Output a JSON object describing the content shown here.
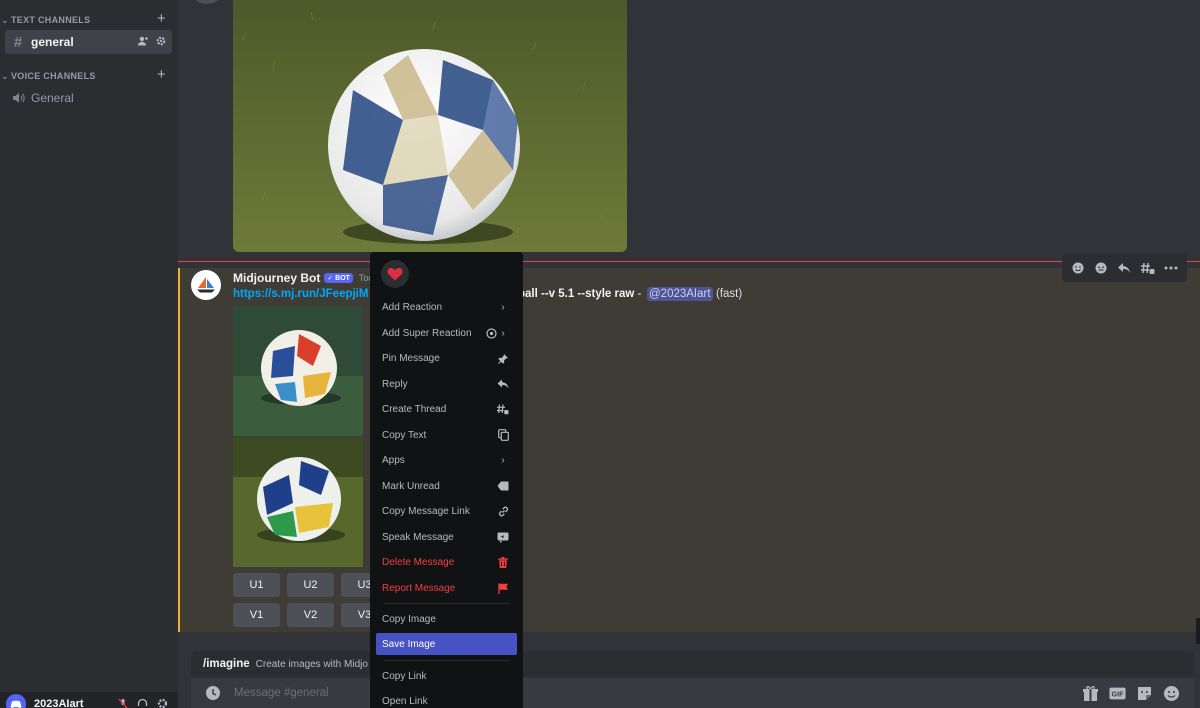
{
  "sidebar": {
    "text_channels_label": "TEXT CHANNELS",
    "voice_channels_label": "VOICE CHANNELS",
    "text_channel": "general",
    "voice_channel": "General"
  },
  "user": {
    "name": "2023AIart"
  },
  "message": {
    "author": "Midjourney Bot",
    "badge": "✓ BOT",
    "timestamp": "Today",
    "link": "https://s.mj.run/JFeepjiM",
    "prompt_tail": "ball --v 5.1 --style raw",
    "separator": "-",
    "mention": "@2023AIart",
    "speed": "(fast)",
    "upscale_buttons": [
      "U1",
      "U2",
      "U3"
    ],
    "variation_buttons": [
      "V1",
      "V2",
      "V3"
    ]
  },
  "slash": {
    "command": "/imagine",
    "description": "Create images with Midjo"
  },
  "composer": {
    "placeholder": "Message #general"
  },
  "context_menu": {
    "items": [
      "Add Reaction",
      "Add Super Reaction",
      "Pin Message",
      "Reply",
      "Create Thread",
      "Copy Text",
      "Apps",
      "Mark Unread",
      "Copy Message Link",
      "Speak Message",
      "Delete Message",
      "Report Message",
      "Copy Image",
      "Save Image",
      "Copy Link",
      "Open Link"
    ]
  },
  "colors": {
    "accent": "#5865f2",
    "danger": "#f23f43",
    "link": "#00a8fc",
    "highlight_bar": "#f0b232"
  }
}
